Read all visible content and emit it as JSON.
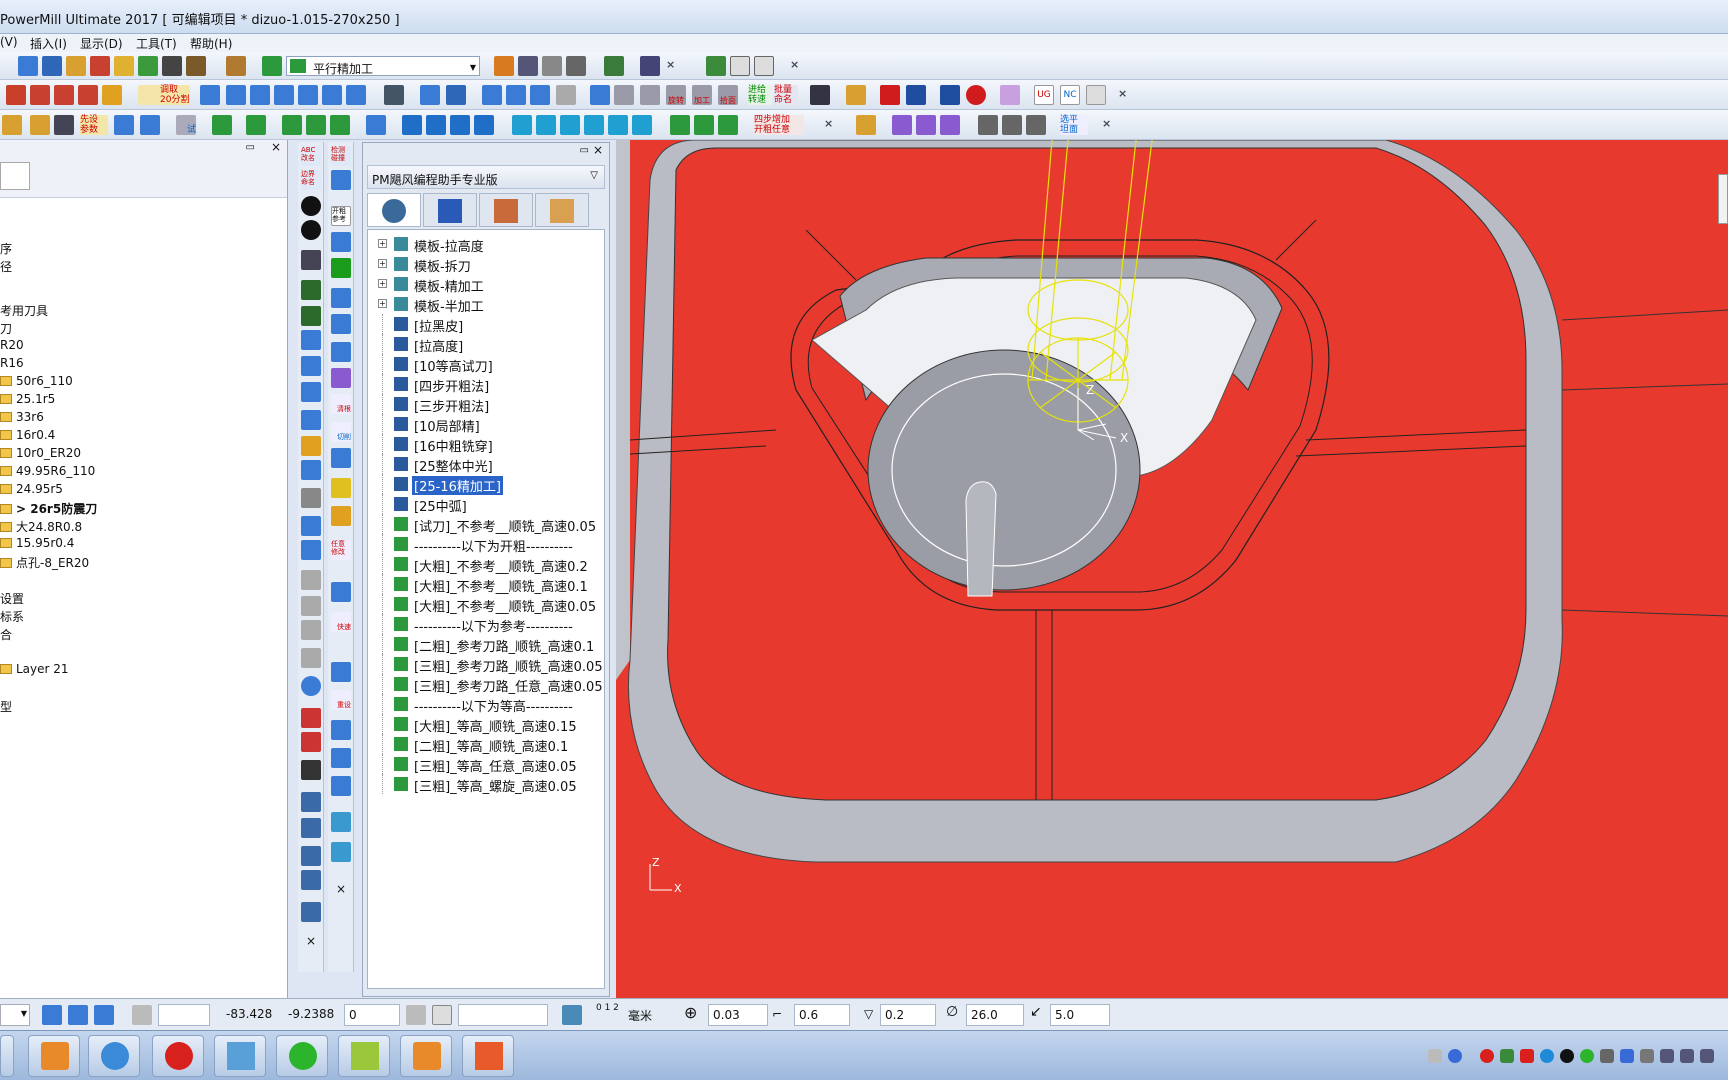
{
  "window": {
    "title": "PowerMill Ultimate 2017    [ 可编辑项目 * dizuo-1.015-270x250 ]"
  },
  "menu": [
    "(V)",
    "插入(I)",
    "显示(D)",
    "工具(T)",
    "帮助(H)"
  ],
  "toolbar": {
    "strategy_combo": "平行精加工",
    "btn_cut_rough": "调取\n20分割",
    "btn_preset": "先设\n参数",
    "btn_trial": "试",
    "btn_feed": "进给\n转速",
    "btn_batch": "批量\n命名",
    "btn_rotate": "旋转",
    "btn_process": "加工",
    "btn_pick": "拾面",
    "btn_four_step": "四步增加\n开粗任意",
    "btn_flat": "选平\n坦面",
    "btn_ug": "UG",
    "btn_nc": "NC"
  },
  "left_panel": {
    "items": [
      {
        "label": "序"
      },
      {
        "label": "径"
      },
      {
        "label": "考用刀具"
      },
      {
        "label": "刀"
      },
      {
        "label": "R20"
      },
      {
        "label": "R16"
      },
      {
        "label": "50r6_110",
        "folder": true
      },
      {
        "label": "25.1r5",
        "folder": true
      },
      {
        "label": "33r6",
        "folder": true
      },
      {
        "label": "16r0.4",
        "folder": true
      },
      {
        "label": "10r0_ER20",
        "folder": true
      },
      {
        "label": "49.95R6_110",
        "folder": true
      },
      {
        "label": "24.95r5",
        "folder": true
      },
      {
        "label": "> 26r5防震刀",
        "folder": true,
        "bold": true
      },
      {
        "label": "大24.8R0.8",
        "folder": true
      },
      {
        "label": "15.95r0.4",
        "folder": true
      },
      {
        "label": "点孔-8_ER20",
        "folder": true
      },
      {
        "label": "设置"
      },
      {
        "label": "标系"
      },
      {
        "label": "合"
      },
      {
        "label": "Layer 21",
        "folder": true
      },
      {
        "label": "型"
      }
    ]
  },
  "vstrip1": {
    "label_top": "ABC\n改名",
    "label_border": "边界\n命名"
  },
  "vstrip2": {
    "label_top": "检测\n碰撞",
    "label_open": "开粗\n参考",
    "label_clean": "清根",
    "label_cut": "切削",
    "label_reset": "重设",
    "label_quick": "快速",
    "label_comp": "任意\n修改"
  },
  "pm_panel": {
    "title": "PM飓风编程助手专业版",
    "items": [
      {
        "label": "模板-拉高度",
        "type": "template",
        "expand": true
      },
      {
        "label": "模板-拆刀",
        "type": "template",
        "expand": true
      },
      {
        "label": "模板-精加工",
        "type": "template",
        "expand": true
      },
      {
        "label": "模板-半加工",
        "type": "template",
        "expand": true
      },
      {
        "label": "[拉黑皮]",
        "type": "list"
      },
      {
        "label": "[拉高度]",
        "type": "list"
      },
      {
        "label": "[10等高试刀]",
        "type": "list"
      },
      {
        "label": "[四步开粗法]",
        "type": "list"
      },
      {
        "label": "[三步开粗法]",
        "type": "list"
      },
      {
        "label": "[10局部精]",
        "type": "list"
      },
      {
        "label": "[16中粗铣穿]",
        "type": "list"
      },
      {
        "label": "[25整体中光]",
        "type": "list"
      },
      {
        "label": "[25-16精加工]",
        "type": "list",
        "selected": true
      },
      {
        "label": "[25中弧]",
        "type": "list"
      },
      {
        "label": "[试刀]_不参考__顺铣_高速0.05",
        "type": "path"
      },
      {
        "label": "----------以下为开粗----------",
        "type": "path"
      },
      {
        "label": "[大粗]_不参考__顺铣_高速0.2",
        "type": "path"
      },
      {
        "label": "[大粗]_不参考__顺铣_高速0.1",
        "type": "path"
      },
      {
        "label": "[大粗]_不参考__顺铣_高速0.05",
        "type": "path"
      },
      {
        "label": "----------以下为参考----------",
        "type": "path"
      },
      {
        "label": "[二粗]_参考刀路_顺铣_高速0.1",
        "type": "path"
      },
      {
        "label": "[三粗]_参考刀路_顺铣_高速0.05",
        "type": "path"
      },
      {
        "label": "[三粗]_参考刀路_任意_高速0.05",
        "type": "path"
      },
      {
        "label": "----------以下为等高----------",
        "type": "path"
      },
      {
        "label": "[大粗]_等高_顺铣_高速0.15",
        "type": "path"
      },
      {
        "label": "[二粗]_等高_顺铣_高速0.1",
        "type": "path"
      },
      {
        "label": "[三粗]_等高_任意_高速0.05",
        "type": "path"
      },
      {
        "label": "[三粗]_等高_螺旋_高速0.05",
        "type": "path"
      }
    ]
  },
  "viewport": {
    "axis_x": "X",
    "axis_z": "Z"
  },
  "status": {
    "coord_x": "-83.428",
    "coord_y": "-9.2388",
    "coord_z": "0",
    "unit": "毫米",
    "tolerance": "0.03",
    "stock": "0.6",
    "thickness": "0.2",
    "diameter": "26.0",
    "step": "5.0",
    "scale_label": "0 1 2"
  },
  "colors": {
    "viewport_bg": "#e8392e",
    "model_face": "#b9bcc4",
    "tool_wire": "#e6e20a",
    "selection": "#2a64c8"
  }
}
